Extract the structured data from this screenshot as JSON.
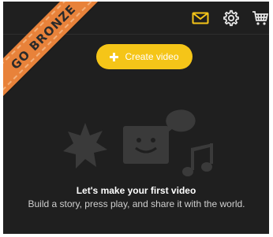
{
  "ribbon": {
    "text": "GO BRONZE"
  },
  "topbar": {
    "icons": [
      "mail-icon",
      "gear-icon",
      "cart-icon"
    ],
    "accent": "#f5c518"
  },
  "create_button": {
    "label": "Create video"
  },
  "empty_state": {
    "title": "Let's make your first video",
    "description": "Build a story, press play, and share it with the world."
  },
  "colors": {
    "background": "#1f1f1f",
    "ribbon": "#e8823a",
    "button": "#f5c518",
    "illustration": "#3a3a3a"
  }
}
